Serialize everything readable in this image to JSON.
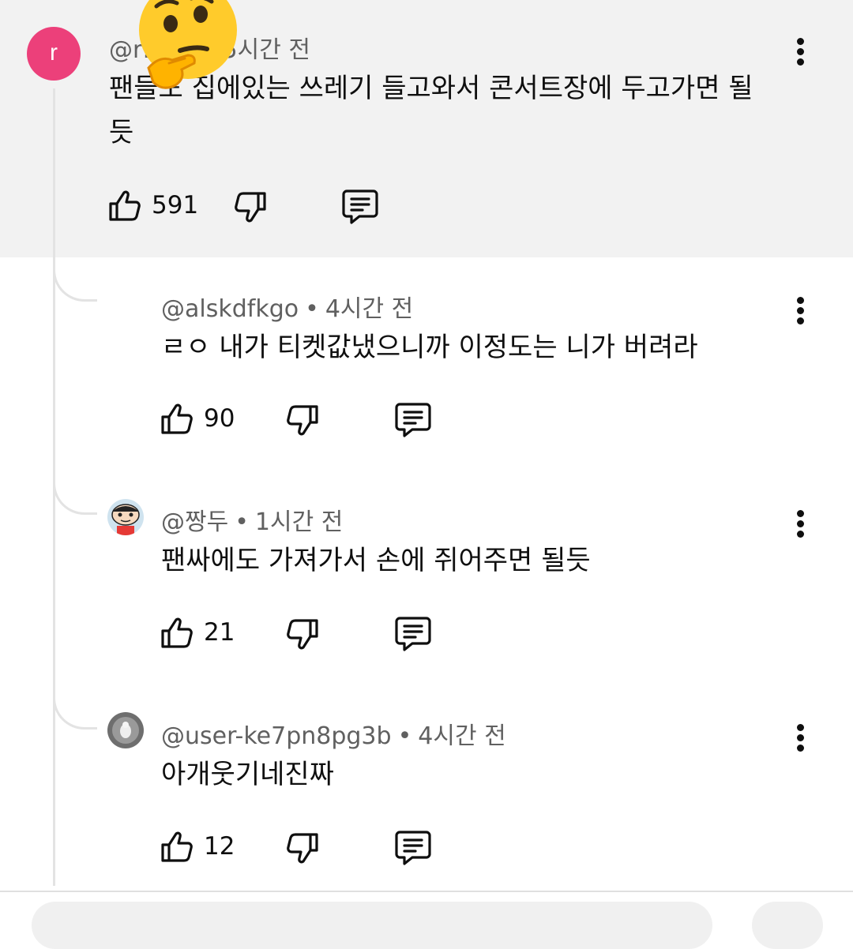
{
  "parent": {
    "avatar_letter": "r",
    "handle": "@r…be",
    "time": "5시간 전",
    "text": "팬들도 집에있는 쓰레기 들고와서 콘서트장에 두고가면 될듯",
    "likes": "591"
  },
  "replies": [
    {
      "handle": "@alskdfkgo",
      "time": "4시간 전",
      "text": "ㄹㅇ 내가 티켓값냈으니까 이정도는 니가 버려라",
      "likes": "90"
    },
    {
      "handle": "@짱두",
      "time": "1시간 전",
      "text": "팬싸에도 가져가서 손에 쥐어주면 될듯",
      "likes": "21"
    },
    {
      "handle": "@user-ke7pn8pg3b",
      "time": "4시간 전",
      "text": "아개웃기네진짜",
      "likes": "12"
    }
  ],
  "separator": "•",
  "icons": {
    "like": "thumbs-up-icon",
    "dislike": "thumbs-down-icon",
    "reply": "comment-icon",
    "more": "more-vert-icon",
    "overlay": "thinking-face-emoji"
  },
  "colors": {
    "parent_background": "#f2f2f2",
    "avatar_pink": "#ec407a",
    "meta_gray": "#606060",
    "thread_line": "#e3e3e3"
  }
}
